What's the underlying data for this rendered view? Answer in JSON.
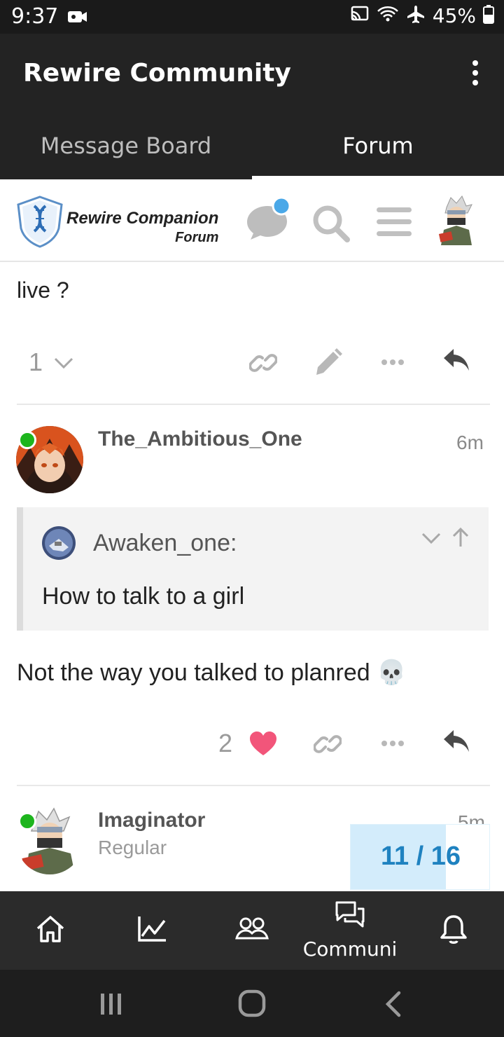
{
  "status_bar": {
    "time": "9:37",
    "battery": "45%",
    "icons": [
      "video-record-icon",
      "cast-icon",
      "wifi-icon",
      "airplane-icon",
      "battery-icon"
    ]
  },
  "app_bar": {
    "title": "Rewire Community",
    "menu_icon": "more-vertical-icon"
  },
  "tabs": [
    {
      "label": "Message Board",
      "active": false
    },
    {
      "label": "Forum",
      "active": true
    }
  ],
  "forum_header": {
    "logo_line1": "Rewire Companion",
    "logo_line2": "Forum",
    "icons": [
      "chat-icon",
      "search-icon",
      "hamburger-menu-icon",
      "user-avatar"
    ],
    "chat_badge_color": "#4aa8e8"
  },
  "posts": [
    {
      "text_fragment": "live ?",
      "like_count": "1",
      "actions": [
        "chevron-down-icon",
        "link-icon",
        "edit-icon",
        "more-horizontal-icon",
        "reply-icon"
      ]
    },
    {
      "username": "The_Ambitious_One",
      "time": "6m",
      "online": true,
      "quote": {
        "author": "Awaken_one:",
        "text": "How to talk to a girl"
      },
      "body": "Not the way you talked to planred 💀",
      "like_count": "2",
      "liked_color": "#f2557a",
      "actions": [
        "heart-icon",
        "link-icon",
        "more-horizontal-icon",
        "reply-icon"
      ]
    },
    {
      "username": "Imaginator",
      "user_title": "Regular",
      "time": "5m",
      "online": true
    }
  ],
  "progress": {
    "label": "11 / 16",
    "fraction": 0.6875
  },
  "bottom_nav": {
    "items": [
      {
        "icon": "home-icon",
        "label": ""
      },
      {
        "icon": "chart-icon",
        "label": ""
      },
      {
        "icon": "people-icon",
        "label": ""
      },
      {
        "icon": "community-chat-icon",
        "label": "Communi"
      },
      {
        "icon": "bell-icon",
        "label": ""
      }
    ]
  },
  "system_nav": [
    "recents-icon",
    "home-circle-icon",
    "back-icon"
  ],
  "colors": {
    "accent_blue": "#1f82c0",
    "online_green": "#1db51d",
    "heart_pink": "#f2557a"
  }
}
